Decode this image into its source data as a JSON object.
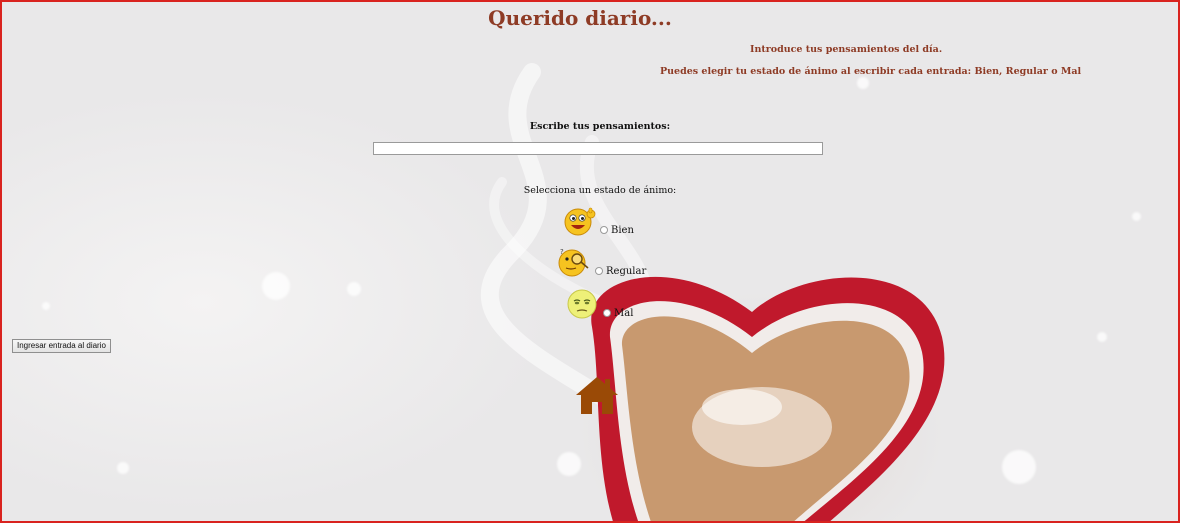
{
  "header": {
    "title": "Querido diario...",
    "intro_line1": "Introduce tus pensamientos del día.",
    "intro_line2": "Puedes elegir tu estado de ánimo al escribir cada entrada: Bien, Regular o Mal"
  },
  "form": {
    "thoughts_label": "Escribe tus pensamientos:",
    "thoughts_value": "",
    "mood_label": "Selecciona un estado de ánimo:",
    "moods": [
      {
        "label": "Bien",
        "icon": "happy-face-icon",
        "selected": false
      },
      {
        "label": "Regular",
        "icon": "thinking-face-icon",
        "selected": false
      },
      {
        "label": "Mal",
        "icon": "sad-face-icon",
        "selected": false
      }
    ],
    "submit_label": "Ingresar entrada al diario"
  },
  "nav": {
    "home_icon": "home-icon"
  },
  "colors": {
    "accent": "#8e3b25",
    "frame_border": "#d9231f",
    "home_icon": "#9a4a06",
    "cup": "#c0192c"
  }
}
